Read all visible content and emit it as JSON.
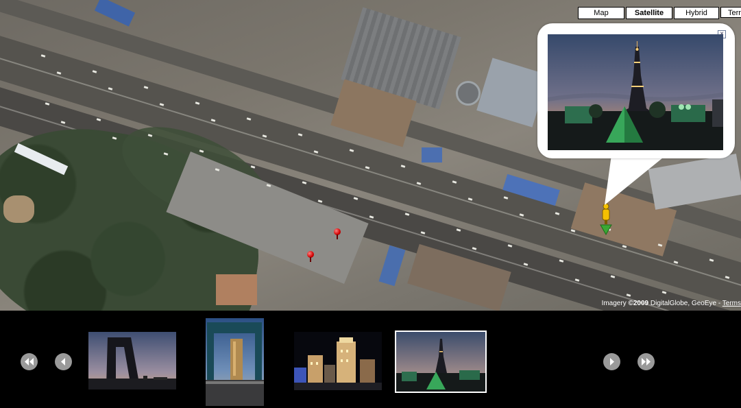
{
  "map": {
    "type_buttons": [
      {
        "label": "Map",
        "active": false
      },
      {
        "label": "Satellite",
        "active": true
      },
      {
        "label": "Hybrid",
        "active": false
      },
      {
        "label": "Terrain",
        "active": false
      }
    ],
    "copyright": {
      "prefix": "Imagery ",
      "holder": "©2009",
      "suffix": " DigitalGlobe, GeoEye - ",
      "terms_link": "Terms"
    },
    "bubble": {
      "close_icon": "close-icon",
      "photo_subject": "eiffel-tower-replica-night"
    }
  },
  "filmstrip": {
    "icons": {
      "first": "rewind-icon",
      "prev": "previous-icon",
      "next": "next-icon",
      "last": "fast-forward-icon"
    },
    "thumbnails": [
      {
        "subject": "gate-arch-silhouette",
        "selected": false
      },
      {
        "subject": "gate-arch-tower",
        "selected": false
      },
      {
        "subject": "night-buildings",
        "selected": false
      },
      {
        "subject": "eiffel-tower-replica",
        "selected": true
      }
    ]
  },
  "colors": {
    "selected_outline": "#ffffff",
    "nav_button": "#9a9a9a",
    "marker_red": "#d00000"
  }
}
